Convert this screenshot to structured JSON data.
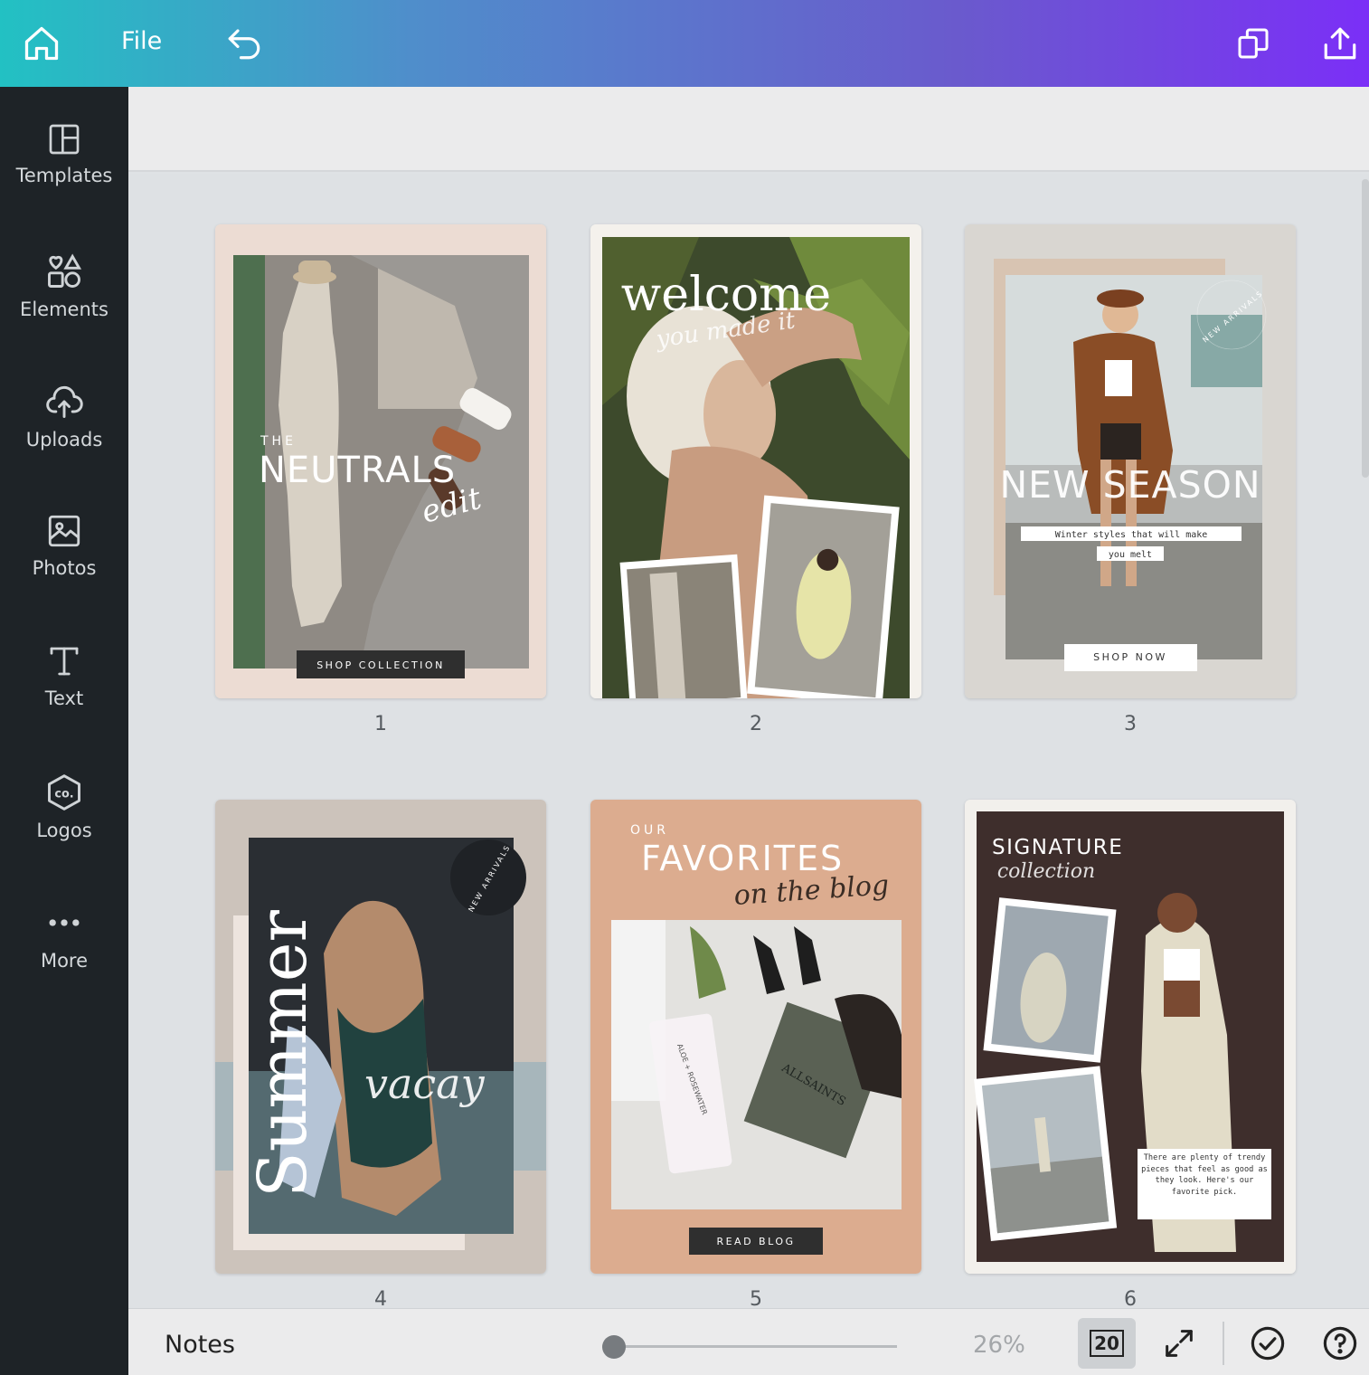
{
  "topbar": {
    "file_label": "File",
    "gradient": [
      "#22c1c3",
      "#7b2ff7"
    ]
  },
  "sidebar": {
    "items": [
      {
        "label": "Templates",
        "icon": "templates-icon"
      },
      {
        "label": "Elements",
        "icon": "elements-icon"
      },
      {
        "label": "Uploads",
        "icon": "upload-cloud-icon"
      },
      {
        "label": "Photos",
        "icon": "photo-icon"
      },
      {
        "label": "Text",
        "icon": "text-icon"
      },
      {
        "label": "Logos",
        "icon": "logo-icon"
      },
      {
        "label": "More",
        "icon": "more-dots-icon"
      }
    ]
  },
  "pages": [
    {
      "number": "1",
      "small_title": "THE",
      "title": "NEUTRALS",
      "script": "edit",
      "button": "SHOP COLLECTION",
      "bg": "#ecdcd3"
    },
    {
      "number": "2",
      "title": "welcome",
      "script": "you made it",
      "bg": "#f4f1ec"
    },
    {
      "number": "3",
      "title": "NEW SEASON",
      "caption_line1": "Winter styles that will make",
      "caption_line2": "you melt",
      "button": "SHOP NOW",
      "stamp": "NEW ARRIVALS",
      "bg": "#d9d6d1"
    },
    {
      "number": "4",
      "title": "Summer",
      "script": "vacay",
      "stamp": "NEW ARRIVALS",
      "bg": "#ccc3bb"
    },
    {
      "number": "5",
      "small_title": "OUR",
      "title": "FAVORITES",
      "script": "on the blog",
      "button": "READ BLOG",
      "product_text1": "ALOE + ROSEWATER",
      "product_text2": "ALLSAINTS",
      "bg": "#dcac8f"
    },
    {
      "number": "6",
      "title": "SIGNATURE",
      "script": "collection",
      "body": "There are plenty of trendy pieces that feel as good as they look. Here's our favorite pick.",
      "bg": "#f2f0ec"
    }
  ],
  "bottombar": {
    "notes_label": "Notes",
    "zoom_value": "26%",
    "zoom_fraction": 0.04,
    "page_count": "20"
  }
}
